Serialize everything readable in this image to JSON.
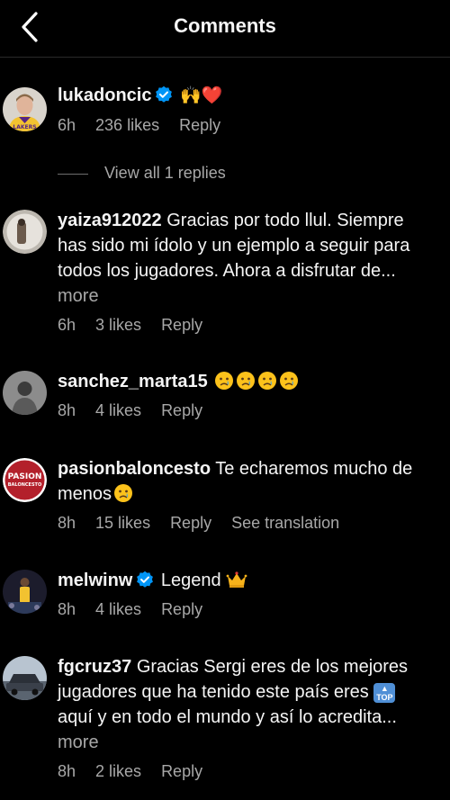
{
  "header": {
    "title": "Comments"
  },
  "comments": [
    {
      "username": "lukadoncic",
      "verified": true,
      "text": "🙌❤️",
      "time": "6h",
      "likes": "236 likes",
      "reply": "Reply",
      "view_replies": "View all 1 replies"
    },
    {
      "username": "yaiza912022",
      "text": "Gracias por todo llul. Siempre has sido mi ídolo y un ejemplo a seguir para todos los jugadores. Ahora a disfrutar de...",
      "more": "more",
      "time": "6h",
      "likes": "3 likes",
      "reply": "Reply"
    },
    {
      "username": "sanchez_marta15",
      "emoji": "crying-face x4",
      "time": "8h",
      "likes": "4 likes",
      "reply": "Reply"
    },
    {
      "username": "pasionbaloncesto",
      "text": "Te echaremos mucho de menos",
      "emoji": "crying-face",
      "time": "8h",
      "likes": "15 likes",
      "reply": "Reply",
      "translate": "See translation",
      "avatar_text": [
        "PASION",
        "BALONCESTO"
      ]
    },
    {
      "username": "melwinw",
      "verified": true,
      "text": "Legend",
      "emoji": "crown",
      "time": "8h",
      "likes": "4 likes",
      "reply": "Reply"
    },
    {
      "username": "fgcruz37",
      "text_a": "Gracias Sergi eres de los mejores jugadores que ha tenido este país eres",
      "top_label": "TOP",
      "text_b": "aquí y en todo el mundo y así lo acredita...",
      "more": "more",
      "time": "8h",
      "likes": "2 likes",
      "reply": "Reply"
    }
  ],
  "colors": {
    "background": "#000000",
    "text": "#f5f5f5",
    "secondary": "#a8a8a8",
    "verified": "#0095f6"
  }
}
